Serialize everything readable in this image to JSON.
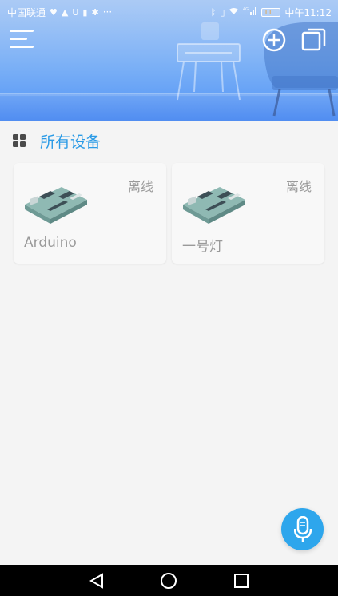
{
  "status_bar": {
    "carrier": "中国联通",
    "left_icons": [
      "heart-monitor-icon",
      "image-icon",
      "u-icon",
      "battery-small-icon",
      "bug-icon"
    ],
    "more": "···",
    "signal_tag": "4G",
    "battery_level": "11",
    "time": "中午11:12"
  },
  "header": {
    "colors": {
      "accent": "#2b9be6",
      "fab": "#2ea6ec"
    }
  },
  "section": {
    "title": "所有设备"
  },
  "devices": [
    {
      "name": "Arduino",
      "status": "离线"
    },
    {
      "name": "一号灯",
      "status": "离线"
    }
  ]
}
